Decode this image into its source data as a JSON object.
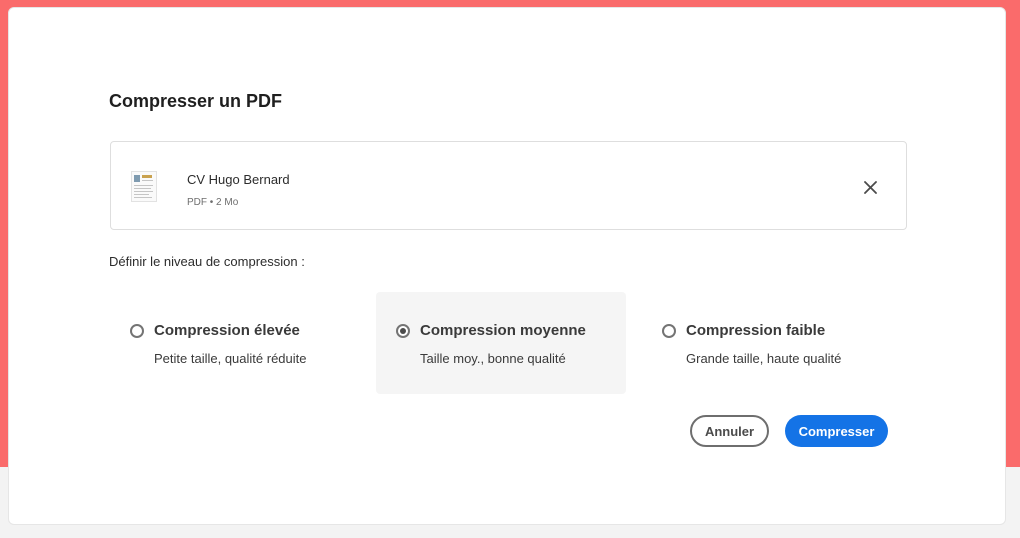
{
  "dialog": {
    "title": "Compresser un PDF"
  },
  "file": {
    "name": "CV Hugo Bernard",
    "meta": "PDF • 2 Mo",
    "thumbnail_icon": "pdf-thumbnail",
    "remove_icon": "close-icon"
  },
  "compression": {
    "label": "Définir le niveau de compression :",
    "options": [
      {
        "title": "Compression élevée",
        "description": "Petite taille, qualité réduite",
        "selected": false
      },
      {
        "title": "Compression moyenne",
        "description": "Taille moy., bonne qualité",
        "selected": true
      },
      {
        "title": "Compression faible",
        "description": "Grande taille, haute qualité",
        "selected": false
      }
    ]
  },
  "actions": {
    "cancel_label": "Annuler",
    "confirm_label": "Compresser"
  },
  "colors": {
    "background_accent": "#fa6b6b",
    "primary_button": "#1473e6",
    "selected_option_bg": "#f5f5f5"
  }
}
